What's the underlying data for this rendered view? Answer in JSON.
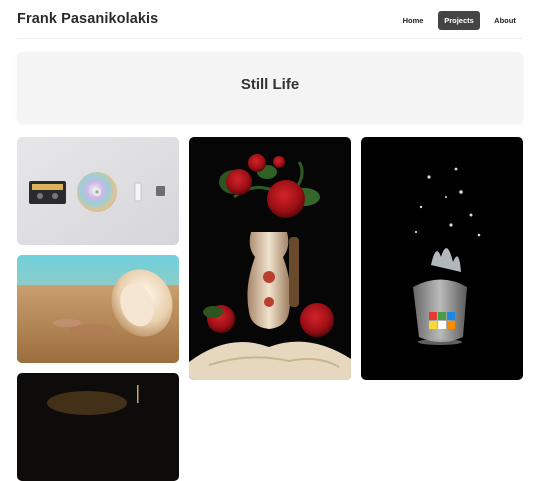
{
  "site": {
    "title": "Frank Pasanikolakis"
  },
  "nav": {
    "items": [
      {
        "label": "Home"
      },
      {
        "label": "Projects"
      },
      {
        "label": "About"
      }
    ]
  },
  "hero": {
    "title": "Still Life"
  },
  "gallery": {
    "photos": [
      {
        "icon": "cassette-cd-objects-photo"
      },
      {
        "icon": "seashell-sand-photo"
      },
      {
        "icon": "candle-dark-photo"
      },
      {
        "icon": "roses-vase-photo"
      },
      {
        "icon": "rubiks-cube-glass-splash-photo"
      }
    ]
  },
  "colors": {
    "accent": "#444444",
    "hero_bg": "#f4f4f4"
  }
}
